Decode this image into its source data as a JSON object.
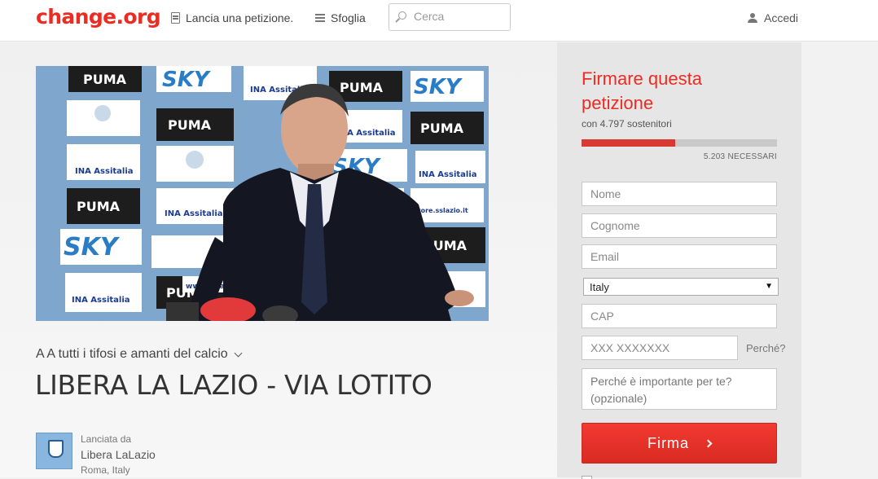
{
  "header": {
    "logo": "change.org",
    "nav_start": "Lancia una petizione.",
    "nav_browse": "Sfoglia",
    "search_placeholder": "Cerca",
    "login": "Accedi"
  },
  "petition": {
    "image": {
      "sponsor_labels": [
        "PUMA",
        "SKY",
        "INA Assitalia",
        "store.sslazio.it",
        "www.sslazio.it"
      ],
      "colors": {
        "backdrop": "#7fa6cc",
        "puma_panel": "#1d1d1d",
        "sky_panel": "#2a7cc7"
      }
    },
    "target": "A A tutti i tifosi e amanti del calcio",
    "title": "LIBERA LA LAZIO - VIA LOTITO",
    "starter": {
      "launched_by": "Lanciata da",
      "name": "Libera LaLazio",
      "location": "Roma, Italy"
    }
  },
  "sign_form": {
    "heading": "Firmare questa petizione",
    "supporters": "con 4.797 sostenitori",
    "progress": {
      "signatures": 4797,
      "remaining": 5203,
      "fraction": 0.48
    },
    "needed": "5.203 NECESSARI",
    "first_name_placeholder": "Nome",
    "last_name_placeholder": "Cognome",
    "email_placeholder": "Email",
    "country": "Italy",
    "zip_placeholder": "CAP",
    "phone_placeholder": "XXX XXXXXXX",
    "why_link": "Perché?",
    "reason_placeholder": "Perché è importante per te? (opzionale)",
    "submit_label": "Firma",
    "accent_color": "#ec2c22"
  }
}
